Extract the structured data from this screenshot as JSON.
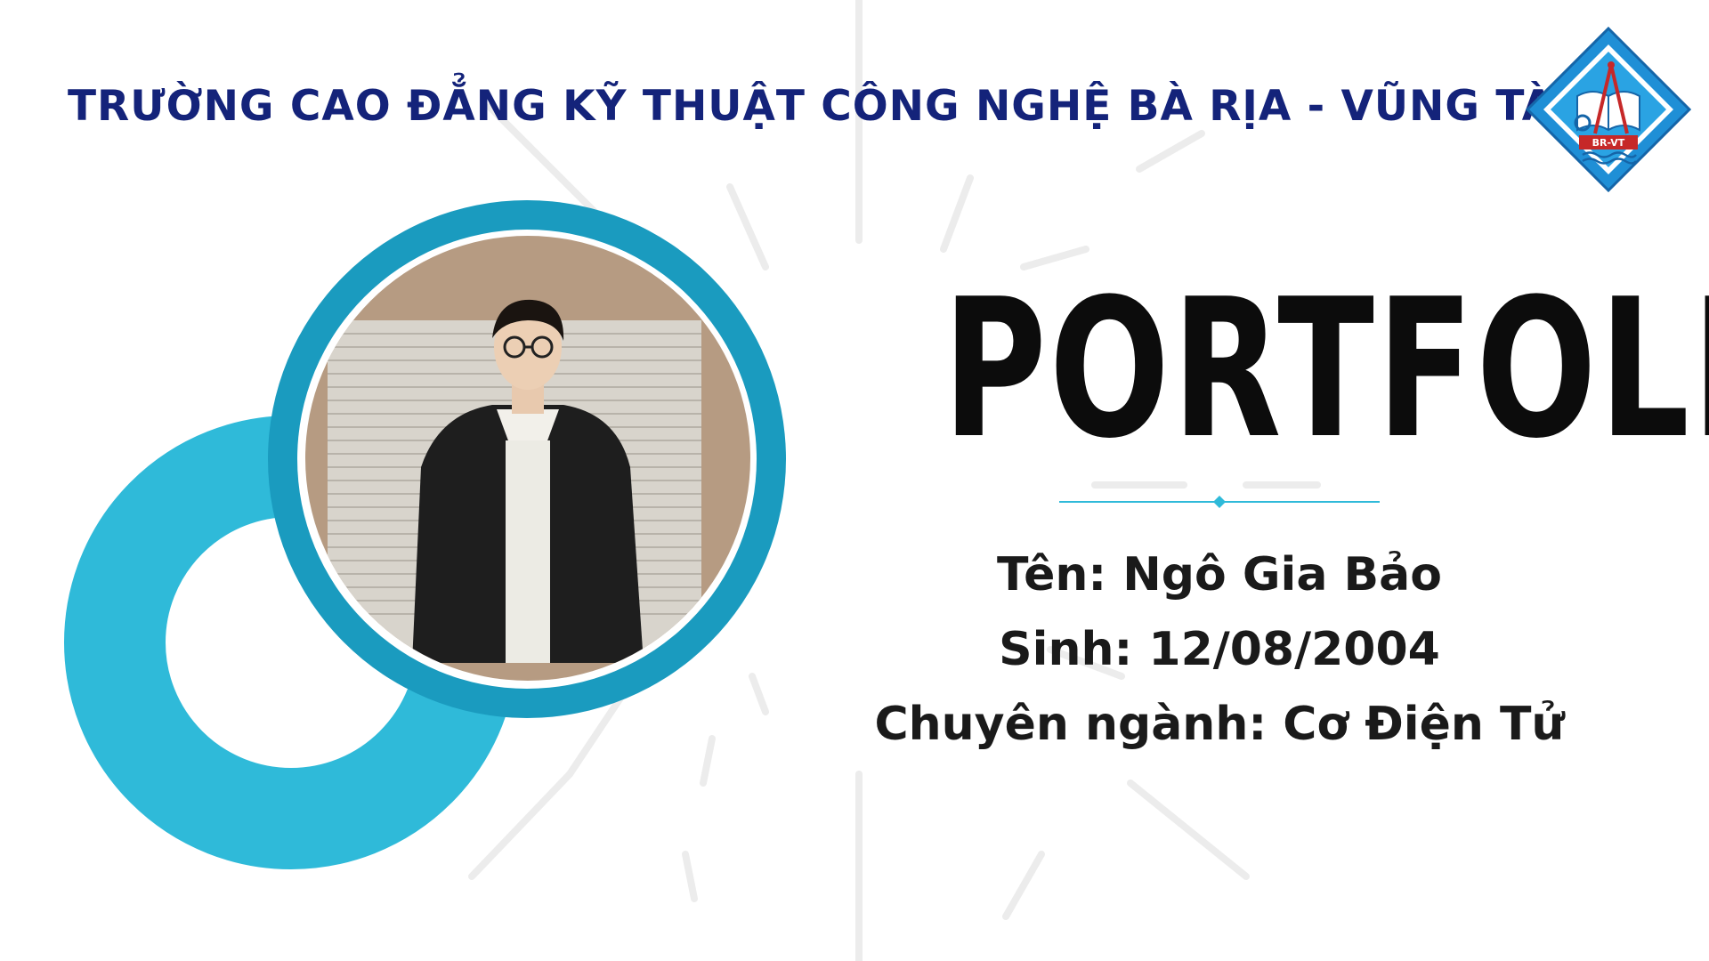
{
  "school": {
    "name": "TRƯỜNG CAO ĐẲNG KỸ THUẬT CÔNG NGHỆ BÀ RỊA - VŨNG TÀU",
    "logo_text": "BR-VT"
  },
  "title": "PORTFOLIO",
  "student": {
    "name_line": "Tên: Ngô Gia Bảo",
    "birth_line": "Sinh: 12/08/2004",
    "major_line": "Chuyên ngành: Cơ Điện Tử"
  },
  "colors": {
    "navy": "#14237a",
    "teal_dark": "#1a9bbf",
    "teal_light": "#2fbad9",
    "text_dark": "#0c0c0c"
  }
}
